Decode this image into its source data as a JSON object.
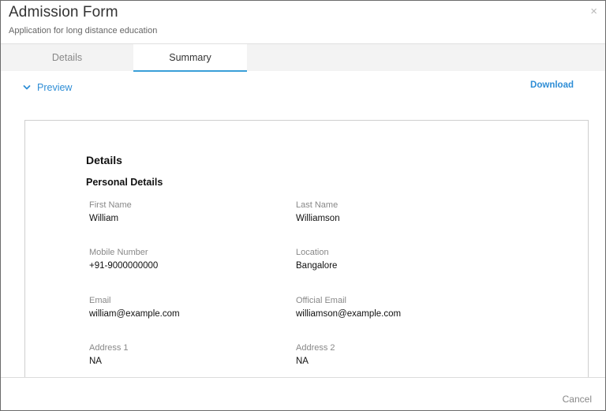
{
  "header": {
    "title": "Admission Form",
    "subtitle": "Application for long distance education",
    "close_icon": "×"
  },
  "tabs": [
    {
      "label": "Details",
      "active": false
    },
    {
      "label": "Summary",
      "active": true
    }
  ],
  "preview": {
    "toggle_label": "Preview",
    "download_label": "Download",
    "section_title": "Details",
    "subsection_title": "Personal Details",
    "fields": {
      "first_name": {
        "label": "First Name",
        "value": "William"
      },
      "last_name": {
        "label": "Last Name",
        "value": "Williamson"
      },
      "mobile": {
        "label": "Mobile Number",
        "value": "+91-9000000000"
      },
      "location": {
        "label": "Location",
        "value": "Bangalore"
      },
      "email": {
        "label": "Email",
        "value": "william@example.com"
      },
      "official_email": {
        "label": "Official Email",
        "value": "williamson@example.com"
      },
      "address1": {
        "label": "Address 1",
        "value": "NA"
      },
      "address2": {
        "label": "Address 2",
        "value": "NA"
      }
    }
  },
  "footer": {
    "cancel_label": "Cancel"
  },
  "colors": {
    "accent": "#2f8ed6",
    "tab_indicator": "#3a9fd8",
    "tab_bar_bg": "#f3f3f3"
  },
  "icons": {
    "close": "close-icon",
    "preview_toggle": "chevron-down-icon"
  }
}
